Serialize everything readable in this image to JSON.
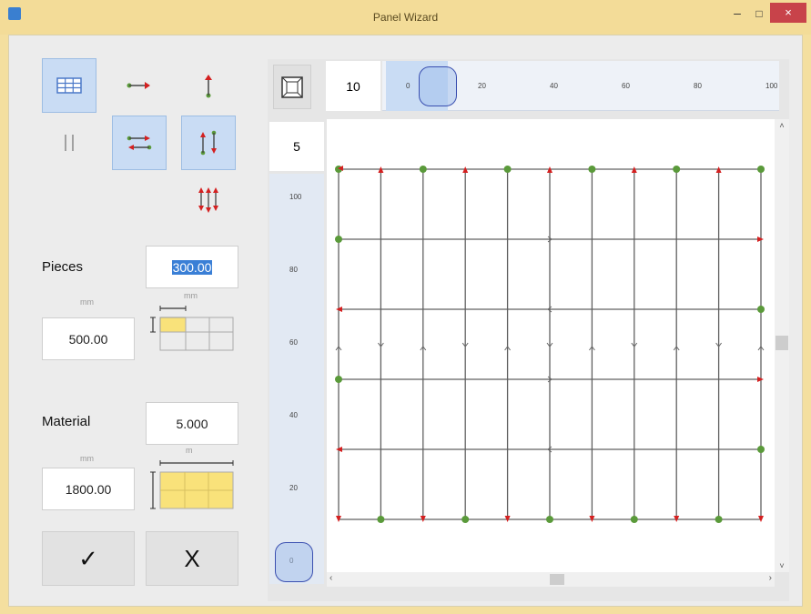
{
  "window": {
    "title": "Panel Wizard",
    "min_label": "–",
    "max_label": "□",
    "close_label": "×"
  },
  "toolbar": {
    "buttons": [
      {
        "name": "grid-layout",
        "selected": true
      },
      {
        "name": "horizontal-arrow",
        "selected": false
      },
      {
        "name": "vertical-arrow",
        "selected": false
      },
      {
        "name": "parallel-lines",
        "selected": false
      },
      {
        "name": "horizontal-alternating",
        "selected": true
      },
      {
        "name": "vertical-alternating",
        "selected": true
      },
      {
        "name": "vertical-double-alternating",
        "selected": false
      }
    ]
  },
  "pieces": {
    "label": "Pieces",
    "width_value": "300.00",
    "width_unit": "mm",
    "height_unit": "mm",
    "height_value": "500.00"
  },
  "material": {
    "label": "Material",
    "length_value": "5.000",
    "length_unit": "m",
    "width_unit": "mm",
    "width_value": "1800.00"
  },
  "actions": {
    "ok_label": "✓",
    "cancel_label": "X"
  },
  "view": {
    "h_spacing": "10",
    "v_spacing": "5",
    "h_ticks": [
      "0",
      "20",
      "40",
      "60",
      "80",
      "100"
    ],
    "v_ticks": [
      "100",
      "80",
      "60",
      "40",
      "20",
      "0"
    ],
    "h_slider_value": 5,
    "v_slider_value": 0
  },
  "colors": {
    "accent": "#c9dcf4",
    "red": "#d42020",
    "green": "#5a9a3a",
    "line": "#606060",
    "highlight": "#f9e27a"
  }
}
